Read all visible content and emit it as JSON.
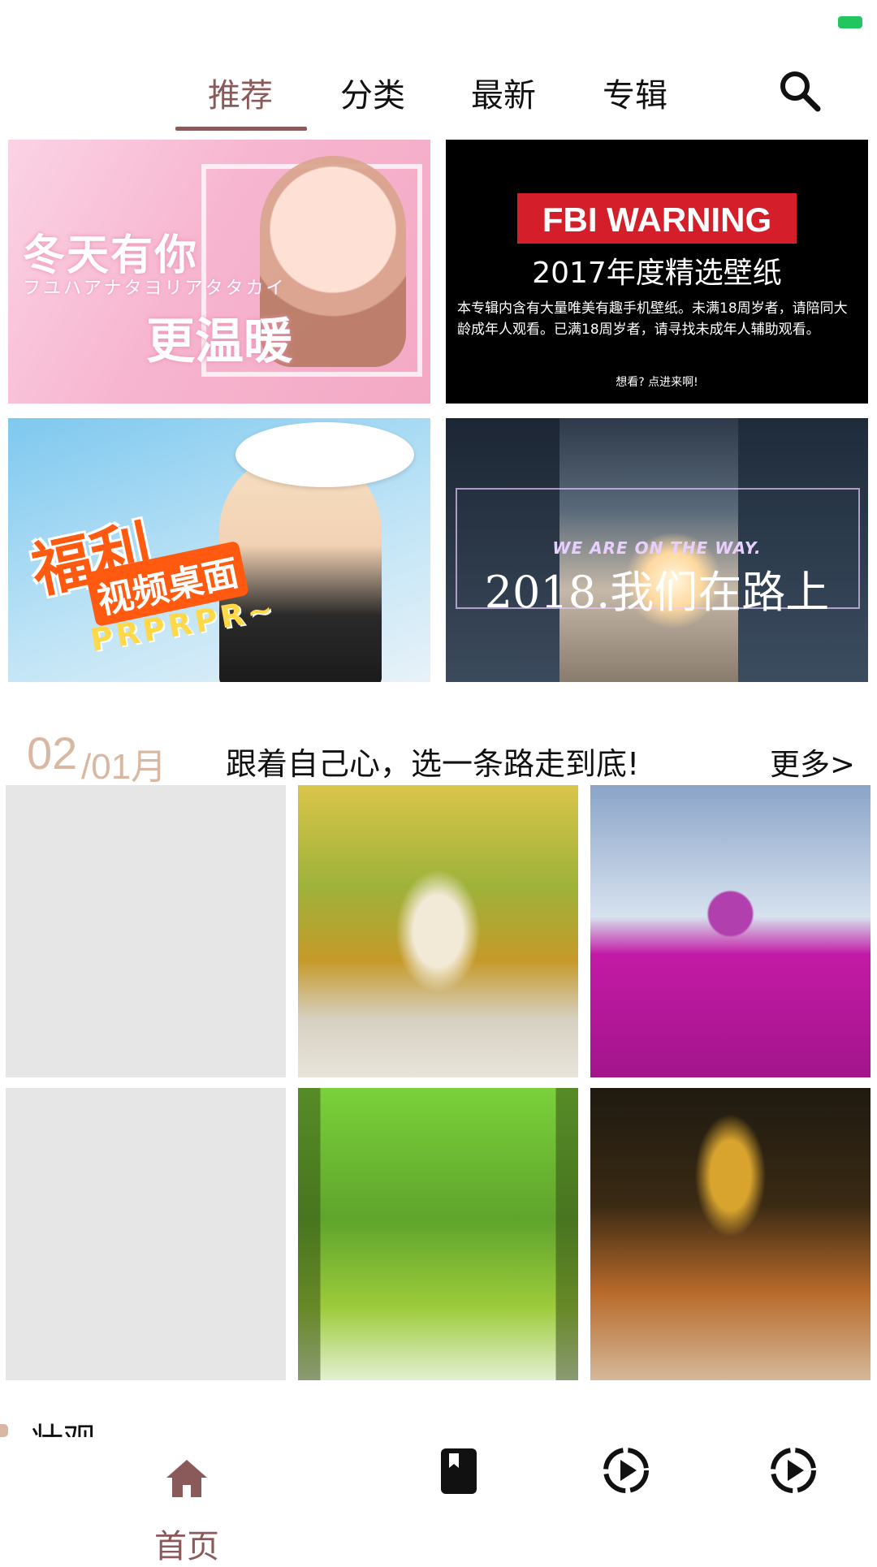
{
  "status_bar": {
    "battery_color": "#22c55e"
  },
  "tabs": [
    {
      "label": "推荐",
      "active": true
    },
    {
      "label": "分类",
      "active": false
    },
    {
      "label": "最新",
      "active": false
    },
    {
      "label": "专辑",
      "active": false
    }
  ],
  "accent_color": "#8a5a5a",
  "banners": [
    {
      "line1": "冬天有你",
      "line2": "フユハアナタヨリアタタカイ",
      "line3": "更温暖"
    },
    {
      "badge": "FBI WARNING",
      "title": "2017年度精选壁纸",
      "body": "本专辑内含有大量唯美有趣手机壁纸。未满18周岁者，请陪同大龄成年人观看。已满18周岁者，请寻找未成年人辅助观看。",
      "footer": "想看? 点进来啊!"
    },
    {
      "line1": "福利",
      "line2": "视频桌面",
      "line3": "PRPRPR~"
    },
    {
      "tagline": "WE ARE ON THE WAY.",
      "title": "2018.我们在路上"
    }
  ],
  "section": {
    "day": "02",
    "month": "/01月",
    "slogan": "跟着自己心，选一条路走到底!",
    "more": "更多>"
  },
  "next_section_peek": "壮观",
  "bottom_nav": [
    {
      "label": "首页",
      "icon": "home-icon",
      "active": true
    },
    {
      "label": "",
      "icon": "bookmark-icon",
      "active": false
    },
    {
      "label": "",
      "icon": "play-icon",
      "active": false
    },
    {
      "label": "",
      "icon": "play-icon",
      "active": false
    }
  ]
}
